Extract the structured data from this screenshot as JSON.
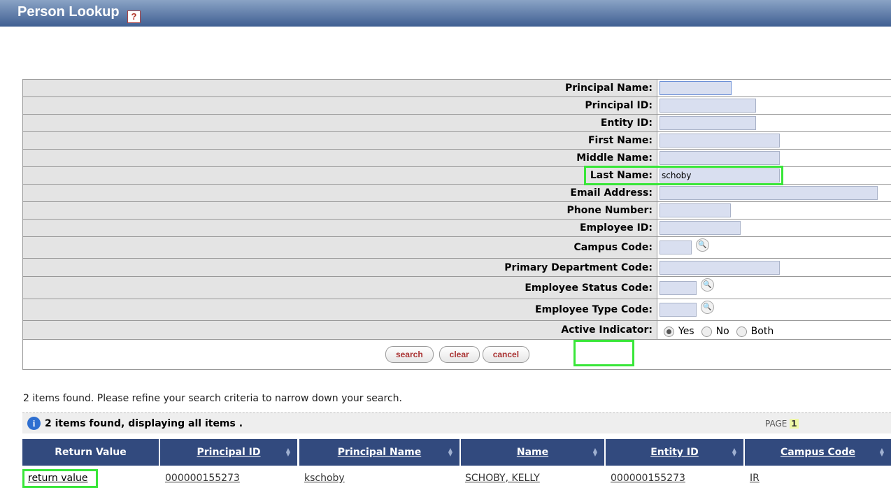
{
  "title": "Person Lookup",
  "help_icon": "help-icon",
  "form": {
    "fields": [
      {
        "label": "Principal Name:",
        "value": ""
      },
      {
        "label": "Principal ID:",
        "value": ""
      },
      {
        "label": "Entity ID:",
        "value": ""
      },
      {
        "label": "First Name:",
        "value": ""
      },
      {
        "label": "Middle Name:",
        "value": ""
      },
      {
        "label": "Last Name:",
        "value": "schoby"
      },
      {
        "label": "Email Address:",
        "value": ""
      },
      {
        "label": "Phone Number:",
        "value": ""
      },
      {
        "label": "Employee ID:",
        "value": ""
      },
      {
        "label": "Campus Code:",
        "value": ""
      },
      {
        "label": "Primary Department Code:",
        "value": ""
      },
      {
        "label": "Employee Status Code:",
        "value": ""
      },
      {
        "label": "Employee Type Code:",
        "value": ""
      },
      {
        "label": "Active Indicator:"
      }
    ],
    "active_options": [
      "Yes",
      "No",
      "Both"
    ],
    "active_selected": "Yes",
    "buttons": {
      "search": "search",
      "clear": "clear",
      "cancel": "cancel"
    }
  },
  "results": {
    "message": "2 items found. Please refine your search criteria to narrow down your search.",
    "banner": "2 items found, displaying all items .",
    "page_label": "PAGE",
    "page_number": "1",
    "headers": [
      "Return Value",
      "Principal ID",
      "Principal Name",
      "Name",
      "Entity ID",
      "Campus Code"
    ],
    "row": {
      "return_value": "return value",
      "principal_id": "000000155273",
      "principal_name": "kschoby",
      "name": "SCHOBY, KELLY",
      "entity_id": "000000155273",
      "campus_code": "IR"
    }
  },
  "colors": {
    "header_bg": "#324a7e",
    "highlight": "#39e639",
    "input_bg": "#d9dff0"
  }
}
